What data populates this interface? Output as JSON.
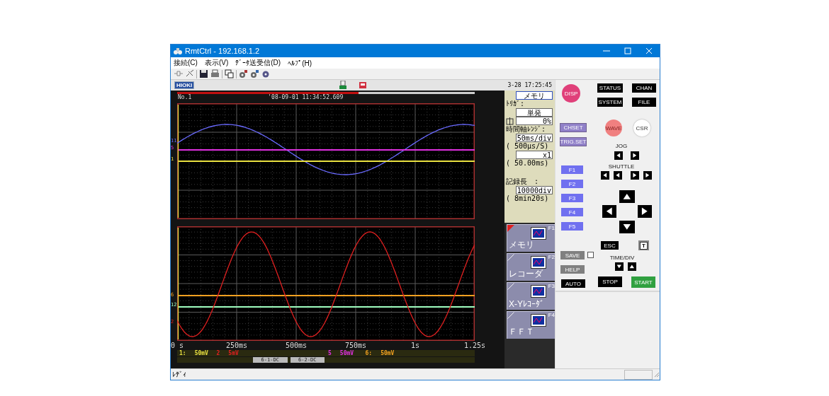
{
  "window": {
    "title": "RmtCtrl - 192.168.1.2"
  },
  "menu": [
    "接続(C)",
    "表示(V)",
    "ﾃﾞｰﾀ送受信(D)",
    "ﾍﾙﾌﾟ(H)"
  ],
  "header": {
    "logo": "HIOKI",
    "clock": "3-28 17:25:45"
  },
  "scope": {
    "record_bar": {
      "level": 0.61
    },
    "shot": "No.1",
    "timestamp": "'08-09-01 11:34:52.609",
    "graphs": [
      {
        "traces": [
          {
            "marker": "11",
            "kind": "sine",
            "color": "#6a6aff"
          },
          {
            "marker": "5",
            "kind": "flat",
            "color": "#e030e0"
          },
          {
            "marker": "1",
            "kind": "flat",
            "color": "#e8e040"
          }
        ]
      },
      {
        "traces": [
          {
            "marker": "6",
            "kind": "flat",
            "color": "#f0a020"
          },
          {
            "marker": "12",
            "kind": "flat",
            "color": "#a0ffc0"
          },
          {
            "marker": "2",
            "kind": "sine",
            "color": "#e02020"
          }
        ]
      }
    ],
    "time_axis": [
      "0 s",
      "250ms",
      "500ms",
      "750ms",
      "1s",
      "1.25s"
    ],
    "channels": [
      {
        "label": "1:",
        "range": "50mV",
        "color": "#e8e040"
      },
      {
        "label": "2",
        "range": "5mV",
        "color": "#e02020"
      },
      {
        "label": "5",
        "range": "50mV",
        "color": "#e030e0"
      },
      {
        "label": "6:",
        "range": "50mV",
        "color": "#f0a020"
      }
    ],
    "inputs": [
      "6-1-DC",
      "6-2-DC"
    ]
  },
  "side_panel": {
    "mode": "メモリ",
    "trigger_label": "ﾄﾘｶﾞ:",
    "trigger": "単発",
    "pretrigger": "0%",
    "timebase_label": "時間軸ﾚﾝｼﾞ:",
    "timebase": "50ms/div",
    "sampling": "( 500μs/S)",
    "magnification": "x1",
    "span": "( 50.00ms)",
    "length_label": "記録長　:",
    "length": "10000div",
    "length_time": "( 8min20s)"
  },
  "function_tabs": [
    {
      "key": "F1",
      "label": "メモリ",
      "selected": true
    },
    {
      "key": "F2",
      "label": "レコーダ",
      "selected": false
    },
    {
      "key": "F3",
      "label": "X-Yﾚｺｰﾀﾞ",
      "selected": false
    },
    {
      "key": "F4",
      "label": "ＦＦＴ",
      "selected": false
    }
  ],
  "control_panel": [
    {
      "label": "DISP",
      "kind": "pink"
    },
    {
      "label": "STATUS",
      "kind": "black"
    },
    {
      "label": "CHAN",
      "kind": "black"
    },
    {
      "label": "SYSTEM",
      "kind": "black"
    },
    {
      "label": "FILE",
      "kind": "black"
    },
    {
      "label": "CHSET",
      "kind": "purple"
    },
    {
      "label": "WAVE",
      "kind": "salmon"
    },
    {
      "label": "CSR",
      "kind": "white"
    },
    {
      "label": "TRIG.SET",
      "kind": "purple"
    },
    {
      "label": "JOG",
      "kind": "label"
    },
    {
      "label": "SHUTTLE",
      "kind": "label"
    },
    {
      "label": "F1",
      "kind": "blue"
    },
    {
      "label": "F2",
      "kind": "blue"
    },
    {
      "label": "F3",
      "kind": "blue"
    },
    {
      "label": "F4",
      "kind": "blue"
    },
    {
      "label": "F5",
      "kind": "blue"
    },
    {
      "label": "ESC",
      "kind": "black"
    },
    {
      "label": "T",
      "kind": "framed"
    },
    {
      "label": "SAVE",
      "kind": "gray"
    },
    {
      "label": "TIME/DIV",
      "kind": "label"
    },
    {
      "label": "HELP",
      "kind": "gray"
    },
    {
      "label": "AUTO",
      "kind": "black"
    },
    {
      "label": "STOP",
      "kind": "black"
    },
    {
      "label": "START",
      "kind": "green"
    }
  ],
  "status_bar": {
    "text": "ﾚﾃﾞｨ"
  }
}
